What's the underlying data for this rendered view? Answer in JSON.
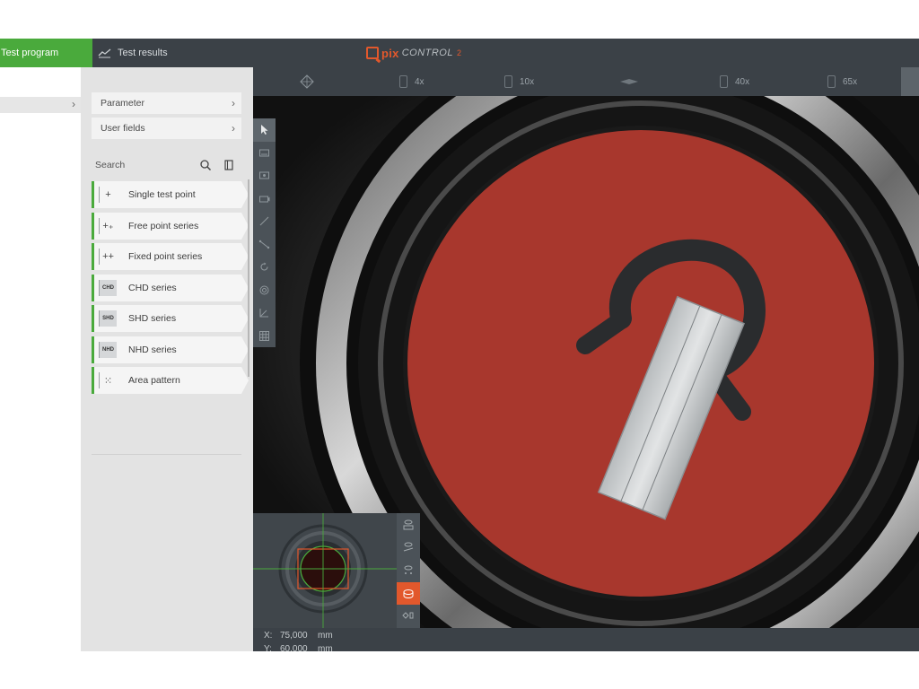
{
  "topbar": {
    "tab_program": "Test program",
    "tab_results": "Test results",
    "logo_pix": "pix",
    "logo_control": "CONTROL",
    "logo_suffix": "2"
  },
  "panel": {
    "menu": [
      {
        "label": "Parameter"
      },
      {
        "label": "User fields"
      }
    ],
    "search_label": "Search",
    "items": [
      {
        "label": "Single test point",
        "icon": "plus-icon",
        "glyph": "+"
      },
      {
        "label": "Free point series",
        "icon": "plus-plus-icon",
        "glyph": "+₊"
      },
      {
        "label": "Fixed point series",
        "icon": "fixed-series-icon",
        "glyph": "++"
      },
      {
        "label": "CHD series",
        "icon": "chd-icon",
        "glyph": "CHD"
      },
      {
        "label": "SHD series",
        "icon": "shd-icon",
        "glyph": "SHD"
      },
      {
        "label": "NHD series",
        "icon": "nhd-icon",
        "glyph": "NHD"
      },
      {
        "label": "Area pattern",
        "icon": "grid-dots-icon",
        "glyph": "⁙"
      }
    ]
  },
  "magnification": {
    "options": [
      "4x",
      "10x",
      "40x",
      "65x"
    ]
  },
  "coords": {
    "x_label": "X:",
    "x_value": "75,000",
    "x_unit": "mm",
    "y_label": "Y:",
    "y_value": "60,000",
    "y_unit": "mm"
  },
  "colors": {
    "accent_green": "#4aaa3c",
    "accent_orange": "#e2582c",
    "sample_red": "#a8372d"
  }
}
